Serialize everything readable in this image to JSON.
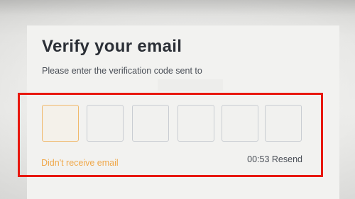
{
  "verify": {
    "title": "Verify your email",
    "subtitle": "Please enter the verification code sent to",
    "code_digits": [
      "",
      "",
      "",
      "",
      "",
      ""
    ],
    "resend_prompt": "Didn't receive email",
    "timer": "00:53",
    "resend_label": "Resend"
  },
  "colors": {
    "accent": "#f0a84a",
    "highlight": "#e8180f",
    "box_border": "#c9cdd2"
  }
}
